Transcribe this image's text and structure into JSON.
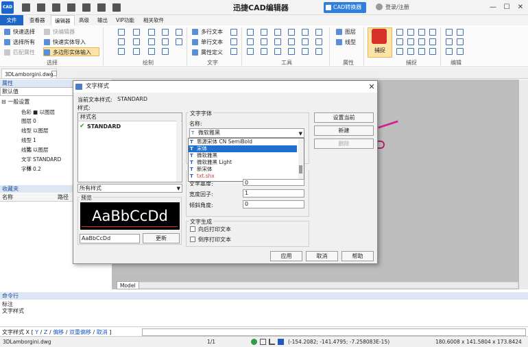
{
  "app": {
    "logo_text": "CAD",
    "title": "迅捷CAD编辑器",
    "converter_label": "CAD转换器",
    "login_label": "登录/注册"
  },
  "window_controls": {
    "minimize": "—",
    "maximize": "☐",
    "close": "✕"
  },
  "menu_tabs": [
    "文件",
    "查看器",
    "编辑器",
    "高级",
    "输出",
    "VIP功能",
    "相关软件"
  ],
  "ribbon": {
    "select": {
      "quick_select": "快速选择",
      "select_all": "选择所有",
      "match_props": "匹配属性",
      "quick_editor": "快编辑器",
      "quick_entity_import": "快速实体导入",
      "polygon_entity_input": "多边形实体输入",
      "label": "选择"
    },
    "draw": {
      "label": "绘制"
    },
    "text": {
      "multiline": "多行文本",
      "singleline": "单行文本",
      "attr_def": "属性定义",
      "label": "文字"
    },
    "tools": {
      "label": "工具"
    },
    "props": {
      "layer": "图层",
      "linetype": "线型",
      "label": "属性"
    },
    "snap": {
      "button": "捕捉",
      "label": "捕捉"
    },
    "edit": {
      "label": "编辑"
    }
  },
  "doc_tab": "3DLamborgini.dwg",
  "props_panel": {
    "header": "属性",
    "default_value": "默认值",
    "group": "⊟ 一般设置",
    "rows": [
      {
        "k": "色彩",
        "v": "■ 以图层"
      },
      {
        "k": "图层",
        "v": "0"
      },
      {
        "k": "线型",
        "v": "以图层"
      },
      {
        "k": "线型比",
        "v": "1"
      },
      {
        "k": "线宽",
        "v": "以图层"
      },
      {
        "k": "文字样",
        "v": "STANDARD"
      },
      {
        "k": "字体",
        "v": "0.2"
      }
    ]
  },
  "favs_panel": {
    "header": "收藏夹",
    "col_name": "名称",
    "col_path": "路径"
  },
  "model_tab": "Model",
  "command": {
    "header": "命令行",
    "history": [
      "标注",
      "文字样式"
    ],
    "prompt": "文字样式",
    "sep": "X [",
    "options": [
      "Y",
      "Z",
      "偏移",
      "双重偏移",
      "取消"
    ],
    "end": "]"
  },
  "status": {
    "file": "3DLamborgini.dwg",
    "page": "1/1",
    "coords": "(-154.2082; -141.4795; -7.258083E-15)",
    "size": "180.6008 x 141.5804 x 173.8424"
  },
  "dialog": {
    "title": "文字样式",
    "current_style_label": "当前文本样式:",
    "current_style": "STANDARD",
    "styles_label": "样式:",
    "list_header": "样式名",
    "styles": [
      "STANDARD"
    ],
    "filter": "所有样式",
    "preview_label": "预览",
    "preview_sample": "AaBbCcDd",
    "preview_input": "AaBbCcDd",
    "update_btn": "更新",
    "set_current_btn": "设置当前",
    "new_btn": "新建",
    "delete_btn": "删除",
    "font_group": "文字字体",
    "font_name_label": "名称:",
    "font_value": "微软雅黑",
    "font_options": [
      "思源宋体 CN SemiBold",
      "宋体",
      "微软雅黑",
      "微软雅黑 Light",
      "新宋体",
      "txt.shx"
    ],
    "font_selected": "宋体",
    "height_label": "文字高度:",
    "height_value": "0",
    "width_label": "宽度因子:",
    "width_value": "1",
    "oblique_label": "倾斜角度:",
    "oblique_value": "0",
    "gen_group": "文字生成",
    "backward_label": "向后打印文本",
    "upside_label": "倒序打印文本",
    "apply_btn": "应用",
    "cancel_btn": "取消",
    "help_btn": "帮助"
  },
  "colors": {
    "accent": "#1c66c9",
    "selection": "#1f6fd0",
    "ribbon_highlight": "#fce4a8",
    "canvas": "#bdbdbd"
  }
}
